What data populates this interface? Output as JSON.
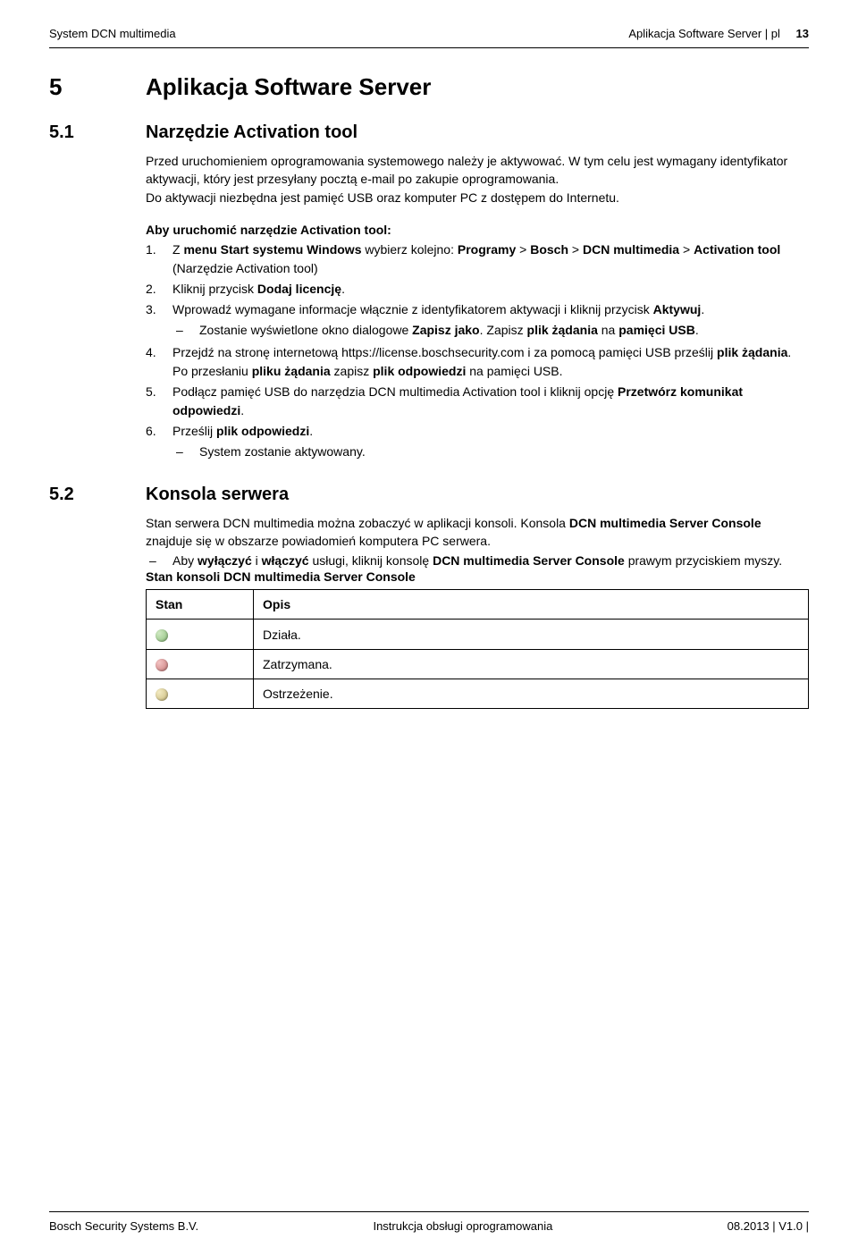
{
  "header": {
    "left": "System DCN multimedia",
    "right_label": "Aplikacja Software Server | pl",
    "page_num": "13"
  },
  "sec5": {
    "num": "5",
    "title": "Aplikacja Software Server"
  },
  "sec51": {
    "num": "5.1",
    "title": "Narzędzie Activation tool",
    "p1": "Przed uruchomieniem oprogramowania systemowego należy je aktywować. W tym celu jest wymagany identyfikator aktywacji, który jest przesyłany pocztą e-mail po zakupie oprogramowania.",
    "p2": "Do aktywacji niezbędna jest pamięć USB oraz komputer PC z dostępem do Internetu.",
    "steps_title": "Aby uruchomić narzędzie Activation tool:",
    "s1_a": "Z ",
    "s1_b": "menu Start systemu Windows",
    "s1_c": " wybierz kolejno: ",
    "s1_d": "Programy",
    "s1_e": " > ",
    "s1_f": "Bosch",
    "s1_g": " > ",
    "s1_h": "DCN multimedia",
    "s1_i": " > ",
    "s1_j": "Activation tool",
    "s1_k": " (Narzędzie Activation tool)",
    "s2_a": "Kliknij przycisk ",
    "s2_b": "Dodaj licencję",
    "s2_c": ".",
    "s3_a": "Wprowadź wymagane informacje włącznie z identyfikatorem aktywacji i kliknij przycisk ",
    "s3_b": "Aktywuj",
    "s3_c": ".",
    "s3_sub_a": "Zostanie wyświetlone okno dialogowe ",
    "s3_sub_b": "Zapisz jako",
    "s3_sub_c": ". Zapisz ",
    "s3_sub_d": "plik żądania",
    "s3_sub_e": " na ",
    "s3_sub_f": "pamięci USB",
    "s3_sub_g": ".",
    "s4_a": "Przejdź na stronę internetową https://license.boschsecurity.com i za pomocą pamięci USB prześlij ",
    "s4_b": "plik żądania",
    "s4_c": ". Po przesłaniu ",
    "s4_d": "pliku żądania",
    "s4_e": " zapisz ",
    "s4_f": "plik odpowiedzi",
    "s4_g": " na pamięci USB.",
    "s5_a": "Podłącz pamięć USB do narzędzia DCN multimedia Activation tool i kliknij opcję ",
    "s5_b": "Przetwórz komunikat odpowiedzi",
    "s5_c": ".",
    "s6_a": "Prześlij ",
    "s6_b": "plik odpowiedzi",
    "s6_c": ".",
    "s6_sub": "System zostanie aktywowany."
  },
  "sec52": {
    "num": "5.2",
    "title": "Konsola serwera",
    "p1_a": "Stan serwera DCN multimedia można zobaczyć w aplikacji konsoli. Konsola ",
    "p1_b": "DCN multimedia Server Console",
    "p1_c": " znajduje się w obszarze powiadomień komputera PC serwera.",
    "bul_a": "Aby ",
    "bul_b": "wyłączyć",
    "bul_c": " i ",
    "bul_d": "włączyć",
    "bul_e": " usługi, kliknij konsolę ",
    "bul_f": "DCN multimedia Server Console",
    "bul_g": " prawym przyciskiem myszy.",
    "table_title": "Stan konsoli DCN multimedia Server Console",
    "th_stan": "Stan",
    "th_opis": "Opis",
    "r1": "Działa.",
    "r2": "Zatrzymana.",
    "r3": "Ostrzeżenie."
  },
  "footer": {
    "left": "Bosch Security Systems B.V.",
    "center": "Instrukcja obsługi oprogramowania",
    "right": "08.2013 | V1.0 |"
  }
}
